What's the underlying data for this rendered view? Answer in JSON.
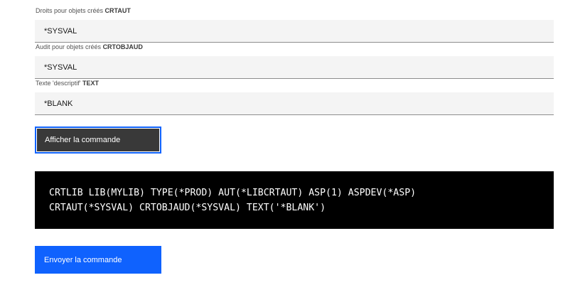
{
  "fields": [
    {
      "label_text": "Droits pour objets créés ",
      "label_keyword": "CRTAUT",
      "value": "*SYSVAL"
    },
    {
      "label_text": "Audit pour objets créés ",
      "label_keyword": "CRTOBJAUD",
      "value": "*SYSVAL"
    },
    {
      "label_text": "Texte 'descriptif' ",
      "label_keyword": "TEXT",
      "value": "*BLANK"
    }
  ],
  "show_command_button": {
    "label": "Afficher la commande"
  },
  "command": {
    "lines": [
      "CRTLIB LIB(MYLIB) TYPE(*PROD) AUT(*LIBCRTAUT) ASP(1) ASPDEV(*ASP)",
      "CRTAUT(*SYSVAL) CRTOBJAUD(*SYSVAL) TEXT('*BLANK')"
    ]
  },
  "submit_button": {
    "label": "Envoyer la commande"
  },
  "colors": {
    "accent": "#0f62fe",
    "field_background": "#f4f4f4",
    "dark_button": "#393939",
    "command_background": "#000000"
  }
}
